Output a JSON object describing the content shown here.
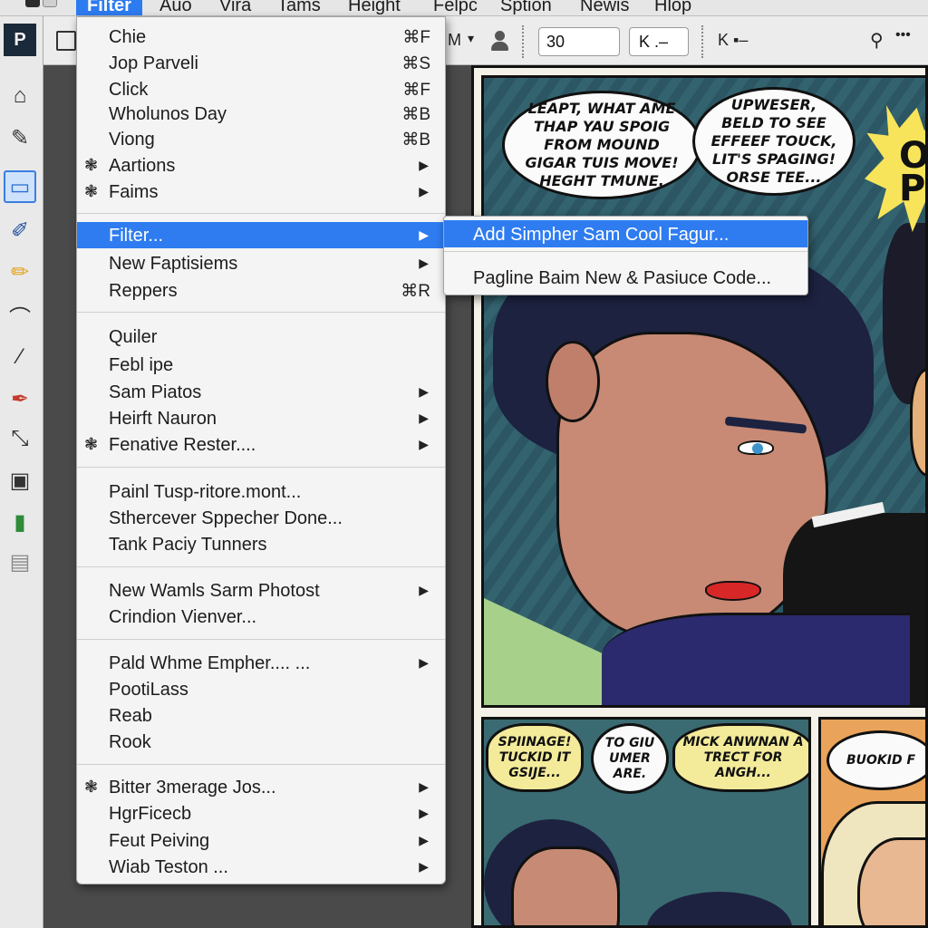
{
  "menubar": {
    "items": [
      "Filter",
      "Auo",
      "Vira",
      "Tams",
      "Height",
      "Felpc",
      "Sption",
      "Newis",
      "Hlop"
    ]
  },
  "toolbar": {
    "mode_label": "M",
    "mode_caret": "▾",
    "size_value": "30",
    "select_value": "K .–",
    "select_caret": "▾",
    "k_label": "K ▪–",
    "key_glyph": "⚲",
    "more_glyph": "•••"
  },
  "tools": [
    {
      "name": "app-logo",
      "glyph": "P"
    },
    {
      "name": "home-icon",
      "glyph": "⌂"
    },
    {
      "name": "edit-icon",
      "glyph": "✎"
    },
    {
      "name": "monitor-icon",
      "glyph": "▭"
    },
    {
      "name": "eraser-icon",
      "glyph": "✐"
    },
    {
      "name": "pencil-icon",
      "glyph": "✏"
    },
    {
      "name": "curve-icon",
      "glyph": "⌒"
    },
    {
      "name": "brush-icon",
      "glyph": "⁄"
    },
    {
      "name": "marker-icon",
      "glyph": "✒"
    },
    {
      "name": "transform-icon",
      "glyph": "⤡"
    },
    {
      "name": "robot-icon",
      "glyph": "▣"
    },
    {
      "name": "color-swatch-icon",
      "glyph": "▮"
    },
    {
      "name": "stamp-icon",
      "glyph": "▤"
    }
  ],
  "menu": {
    "items": [
      {
        "label": "Chie",
        "shortcut": "⌘F"
      },
      {
        "label": "Jop Parveli",
        "shortcut": "⌘S"
      },
      {
        "label": "Click",
        "shortcut": "⌘F"
      },
      {
        "label": "Wholunos Day",
        "shortcut": "⌘B"
      },
      {
        "label": "Viong",
        "shortcut": "⌘B"
      },
      {
        "label": "Aartions",
        "icon": "❃",
        "arrow": "▶"
      },
      {
        "label": "Faims",
        "icon": "❃",
        "arrow": "▶"
      },
      {
        "label": "Filter...",
        "arrow": "▶",
        "highlighted": true
      },
      {
        "label": "New Faptisiems",
        "arrow": "▶"
      },
      {
        "label": "Reppers",
        "shortcut": "⌘R"
      },
      {
        "label": "Quiler"
      },
      {
        "label": "Febl ipe"
      },
      {
        "label": "Sam Piatos",
        "arrow": "▶"
      },
      {
        "label": "Heirft Nauron",
        "arrow": "▶"
      },
      {
        "label": "Fenative Rester....",
        "icon": "❃",
        "arrow": "▶"
      },
      {
        "label": "Painl Tusp-ritore.mont..."
      },
      {
        "label": "Sthercever Sppecher Done..."
      },
      {
        "label": "Tank Paciy Tunners"
      },
      {
        "label": "New Wamls Sarm Photost",
        "arrow": "▶"
      },
      {
        "label": "Crindion Vienver..."
      },
      {
        "label": "Pald Whme Empher.... ...",
        "arrow": "▶"
      },
      {
        "label": "PootiLass"
      },
      {
        "label": "Reab"
      },
      {
        "label": "Rook"
      },
      {
        "label": "Bitter 3merage Jos...",
        "icon": "❃",
        "arrow": "▶"
      },
      {
        "label": "HgrFicecb",
        "arrow": "▶"
      },
      {
        "label": "Feut Peiving",
        "arrow": "▶"
      },
      {
        "label": "Wiab Teston ...",
        "arrow": "▶"
      }
    ]
  },
  "submenu": {
    "items": [
      {
        "label": "Add Simpher Sam Cool Fagur...",
        "highlighted": true
      },
      {
        "label": "Pagline Baim New & Pasiuce Code..."
      }
    ]
  },
  "comic": {
    "balloon1": "LEAPT, WHAT AME THAP YAU SPOIG FROM MOUND GIGAR TUIS MOVE! HEGHT TMUNE.",
    "balloon2": "UPWESER, BELD TO SEE EFFEEF TOUCK, LIT'S SPAGING! ORSE TEE...",
    "burst": "Ou P",
    "b3": "SPIINAGE! TUCKID IT GSIJE...",
    "b4": "TO GIU UMER ARE.",
    "b5": "MICK ANWNAN A TRECT FOR ANGH...",
    "b6": "BUOKID F"
  },
  "colors": {
    "accent": "#2e7cf0",
    "menu_bg": "#f4f4f4",
    "toolbar_bg": "#ececec"
  }
}
